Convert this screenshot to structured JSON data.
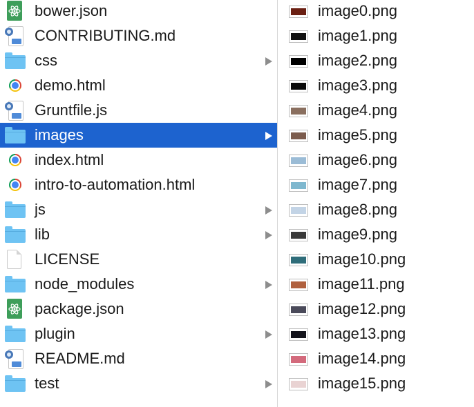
{
  "left_column": [
    {
      "name": "bower.json",
      "icon": "atom-json-icon",
      "folder": false
    },
    {
      "name": "CONTRIBUTING.md",
      "icon": "script-doc-icon",
      "folder": false
    },
    {
      "name": "css",
      "icon": "folder-icon",
      "folder": true
    },
    {
      "name": "demo.html",
      "icon": "chrome-html-icon",
      "folder": false
    },
    {
      "name": "Gruntfile.js",
      "icon": "script-doc-icon",
      "folder": false
    },
    {
      "name": "images",
      "icon": "folder-icon",
      "folder": true,
      "selected": true
    },
    {
      "name": "index.html",
      "icon": "chrome-html-icon",
      "folder": false
    },
    {
      "name": "intro-to-automation.html",
      "icon": "chrome-html-icon",
      "folder": false
    },
    {
      "name": "js",
      "icon": "folder-icon",
      "folder": true
    },
    {
      "name": "lib",
      "icon": "folder-icon",
      "folder": true
    },
    {
      "name": "LICENSE",
      "icon": "document-icon",
      "folder": false
    },
    {
      "name": "node_modules",
      "icon": "folder-icon",
      "folder": true
    },
    {
      "name": "package.json",
      "icon": "atom-json-icon",
      "folder": false
    },
    {
      "name": "plugin",
      "icon": "folder-icon",
      "folder": true
    },
    {
      "name": "README.md",
      "icon": "script-doc-icon",
      "folder": false
    },
    {
      "name": "test",
      "icon": "folder-icon",
      "folder": true
    }
  ],
  "right_column": [
    {
      "name": "image0.png",
      "thumb": "#6a1f12"
    },
    {
      "name": "image1.png",
      "thumb": "#111111"
    },
    {
      "name": "image2.png",
      "thumb": "#000000"
    },
    {
      "name": "image3.png",
      "thumb": "#0a0a0a"
    },
    {
      "name": "image4.png",
      "thumb": "#8a6f5f"
    },
    {
      "name": "image5.png",
      "thumb": "#7b5b4c"
    },
    {
      "name": "image6.png",
      "thumb": "#9bbcd6"
    },
    {
      "name": "image7.png",
      "thumb": "#7fb8cf"
    },
    {
      "name": "image8.png",
      "thumb": "#c3d4e6"
    },
    {
      "name": "image9.png",
      "thumb": "#3a3a3a"
    },
    {
      "name": "image10.png",
      "thumb": "#2f6d7a"
    },
    {
      "name": "image11.png",
      "thumb": "#b0603e"
    },
    {
      "name": "image12.png",
      "thumb": "#4a4a5a"
    },
    {
      "name": "image13.png",
      "thumb": "#14141c"
    },
    {
      "name": "image14.png",
      "thumb": "#d36a7c"
    },
    {
      "name": "image15.png",
      "thumb": "#e9d3d3"
    }
  ],
  "colors": {
    "selection": "#1d63cf",
    "folder": "#6ec3f3",
    "arrow": "#8d8d8d"
  }
}
